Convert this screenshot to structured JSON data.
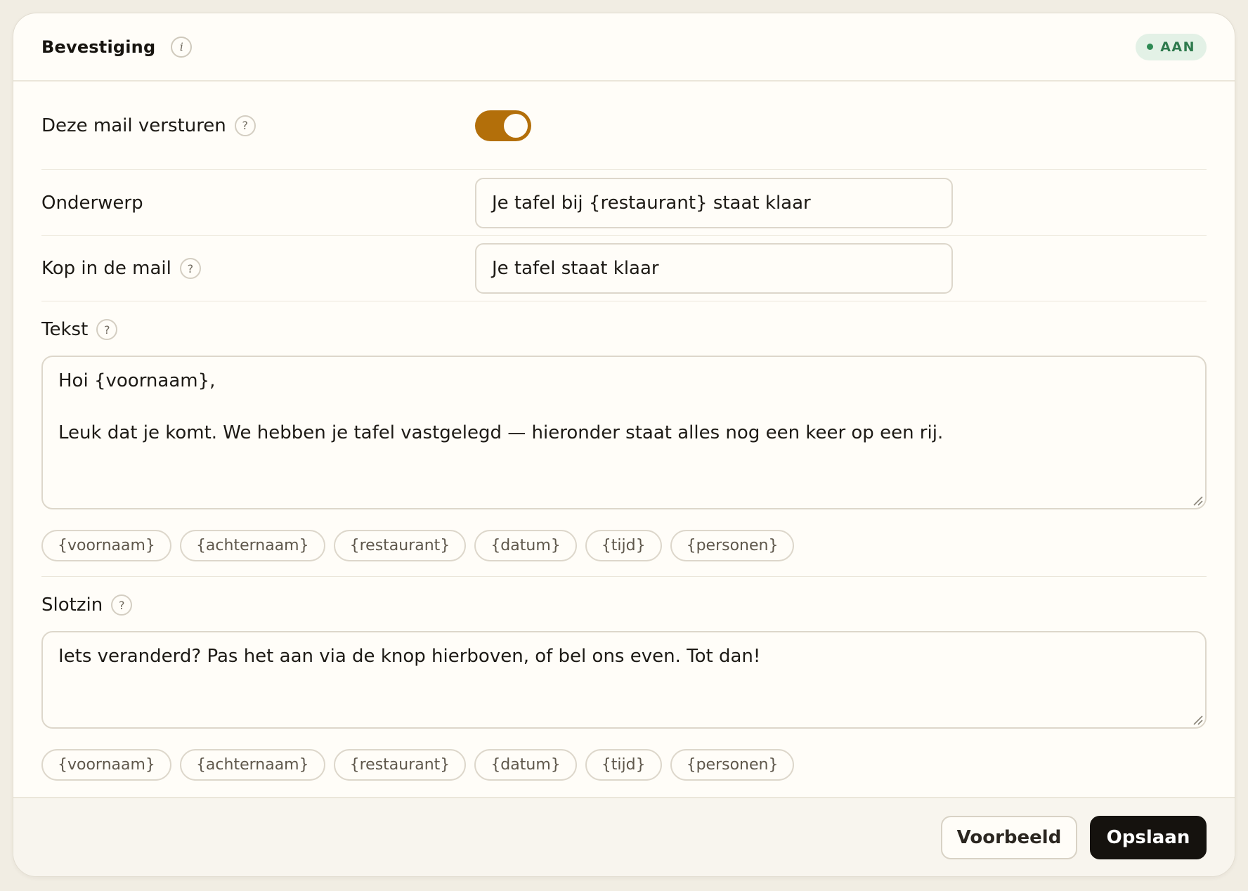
{
  "header": {
    "title": "Bevestiging",
    "info_icon": "i",
    "status": "AAN",
    "status_color": "#2e7a4d"
  },
  "send_mail": {
    "label": "Deze mail versturen",
    "enabled": true,
    "toggle_color": "#b36f0a"
  },
  "subject": {
    "label": "Onderwerp",
    "value": "Je tafel bij {restaurant} staat klaar"
  },
  "heading": {
    "label": "Kop in de mail",
    "value": "Je tafel staat klaar"
  },
  "body_text": {
    "label": "Tekst",
    "value": "Hoi {voornaam},\n\nLeuk dat je komt. We hebben je tafel vastgelegd — hieronder staat alles nog een keer op een rij.",
    "tags": [
      "{voornaam}",
      "{achternaam}",
      "{restaurant}",
      "{datum}",
      "{tijd}",
      "{personen}"
    ]
  },
  "closing": {
    "label": "Slotzin",
    "value": "Iets veranderd? Pas het aan via de knop hierboven, of bel ons even. Tot dan!",
    "tags": [
      "{voornaam}",
      "{achternaam}",
      "{restaurant}",
      "{datum}",
      "{tijd}",
      "{personen}"
    ]
  },
  "help_icon": "?",
  "footer": {
    "preview_label": "Voorbeeld",
    "save_label": "Opslaan"
  }
}
